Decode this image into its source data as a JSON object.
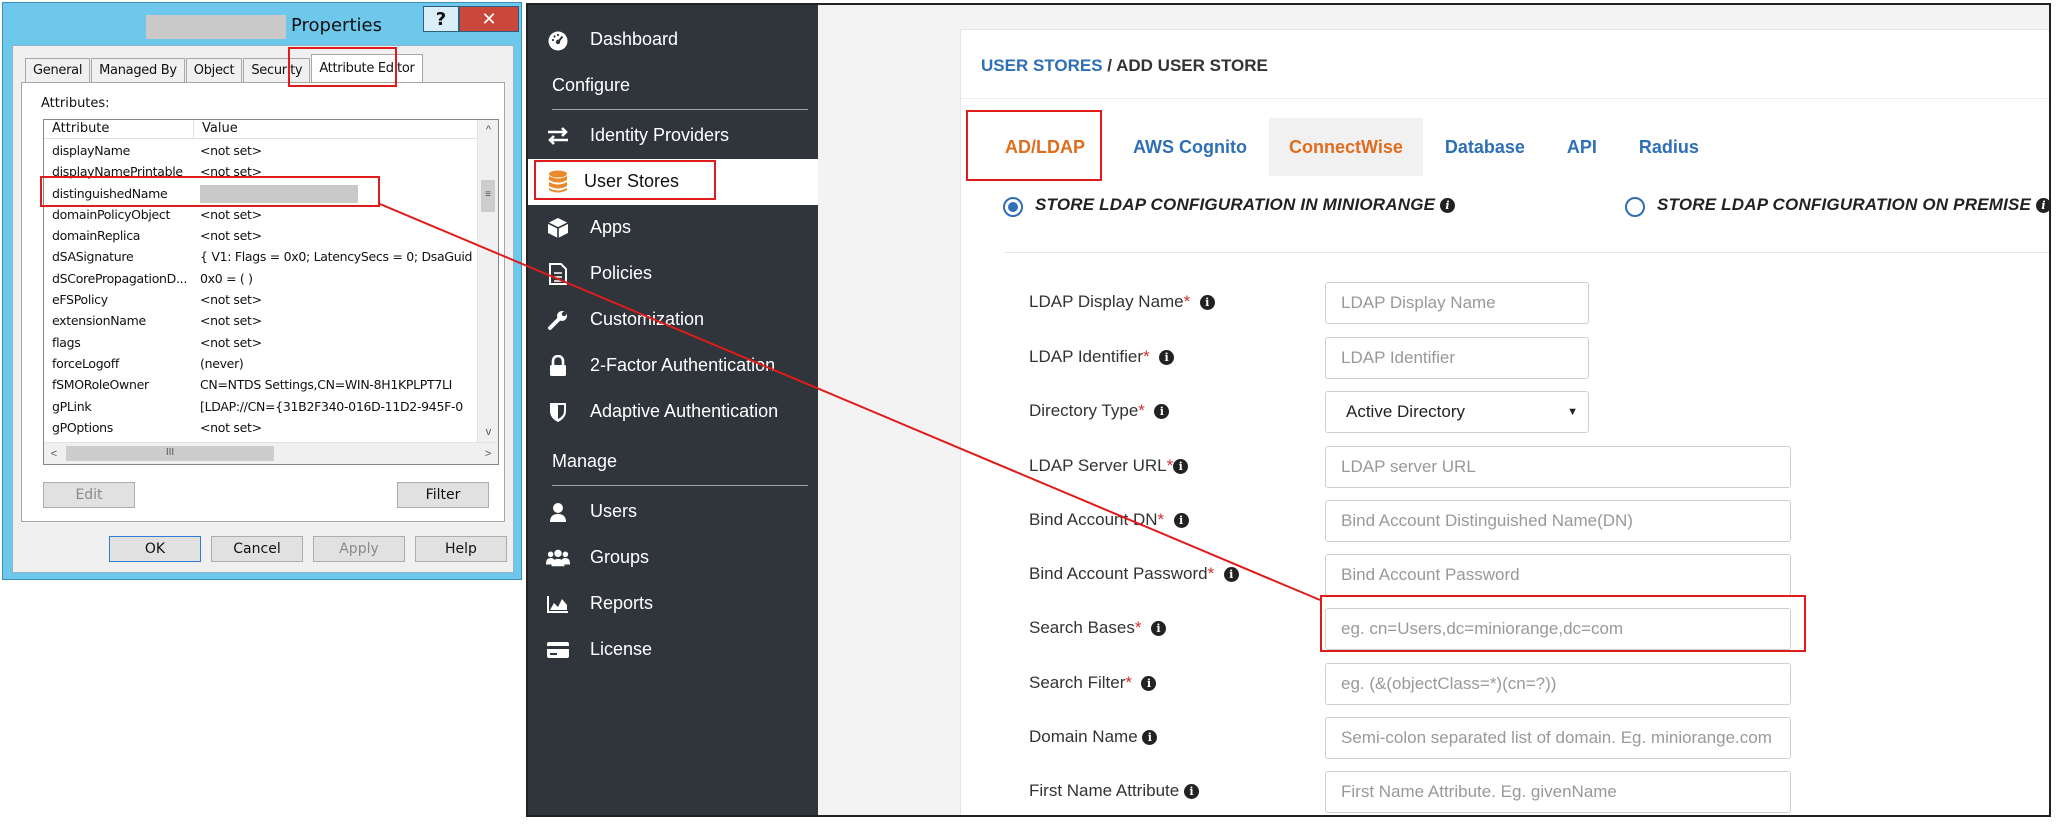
{
  "dialog": {
    "title": "Properties",
    "help_button": "?",
    "close_button": "✕",
    "tabs": [
      "General",
      "Managed By",
      "Object",
      "Security",
      "Attribute Editor"
    ],
    "attributes_caption": "Attributes:",
    "columns": {
      "attribute": "Attribute",
      "value": "Value"
    },
    "rows": [
      {
        "attribute": "displayName",
        "value": "<not set>"
      },
      {
        "attribute": "displayNamePrintable",
        "value": "<not set>"
      },
      {
        "attribute": "distinguishedName",
        "value": ""
      },
      {
        "attribute": "domainPolicyObject",
        "value": "<not set>"
      },
      {
        "attribute": "domainReplica",
        "value": "<not set>"
      },
      {
        "attribute": "dSASignature",
        "value": "{ V1: Flags = 0x0; LatencySecs = 0; DsaGuid"
      },
      {
        "attribute": "dSCorePropagationD...",
        "value": "0x0 = ( )"
      },
      {
        "attribute": "eFSPolicy",
        "value": "<not set>"
      },
      {
        "attribute": "extensionName",
        "value": "<not set>"
      },
      {
        "attribute": "flags",
        "value": "<not set>"
      },
      {
        "attribute": "forceLogoff",
        "value": "(never)"
      },
      {
        "attribute": "fSMORoleOwner",
        "value": "CN=NTDS Settings,CN=WIN-8H1KPLPT7LI"
      },
      {
        "attribute": "gPLink",
        "value": "[LDAP://CN={31B2F340-016D-11D2-945F-0"
      },
      {
        "attribute": "gPOptions",
        "value": "<not set>"
      }
    ],
    "scroll_left": "<",
    "scroll_right": ">",
    "scroll_up": "^",
    "scroll_down": "v",
    "scroll_grip": "III",
    "scroll_grip_v": "≡",
    "edit_button": "Edit",
    "filter_button": "Filter",
    "ok_button": "OK",
    "cancel_button": "Cancel",
    "apply_button": "Apply",
    "help_footer_button": "Help"
  },
  "sidebar": {
    "items_top": [
      {
        "label": "Dashboard",
        "icon": "dashboard-icon"
      }
    ],
    "section_configure": "Configure",
    "items_configure": [
      {
        "label": "Identity Providers",
        "icon": "arrows-exchange-icon"
      },
      {
        "label": "User Stores",
        "icon": "database-icon"
      },
      {
        "label": "Apps",
        "icon": "cube-icon"
      },
      {
        "label": "Policies",
        "icon": "document-icon"
      },
      {
        "label": "Customization",
        "icon": "wrench-icon"
      },
      {
        "label": "2-Factor Authentication",
        "icon": "lock-icon"
      },
      {
        "label": "Adaptive Authentication",
        "icon": "shield-icon"
      }
    ],
    "section_manage": "Manage",
    "items_manage": [
      {
        "label": "Users",
        "icon": "user-icon"
      },
      {
        "label": "Groups",
        "icon": "users-icon"
      },
      {
        "label": "Reports",
        "icon": "area-chart-icon"
      },
      {
        "label": "License",
        "icon": "credit-card-icon"
      }
    ]
  },
  "breadcrumb": {
    "link": "USER STORES",
    "separator": " / ",
    "current": "ADD USER STORE"
  },
  "tabs": [
    "AD/LDAP",
    "AWS Cognito",
    "ConnectWise",
    "Database",
    "API",
    "Radius"
  ],
  "radios": [
    {
      "label": "STORE LDAP CONFIGURATION IN MINIORANGE",
      "checked": true
    },
    {
      "label": "STORE LDAP CONFIGURATION ON PREMISE",
      "checked": false
    }
  ],
  "form": [
    {
      "label": "LDAP Display Name",
      "required": true,
      "placeholder": "LDAP Display Name",
      "type": "text"
    },
    {
      "label": "LDAP Identifier",
      "required": true,
      "placeholder": "LDAP Identifier",
      "type": "text"
    },
    {
      "label": "Directory Type",
      "required": true,
      "value": "Active Directory",
      "type": "select"
    },
    {
      "label": "LDAP Server URL",
      "required": true,
      "placeholder": "LDAP server URL",
      "type": "text"
    },
    {
      "label": "Bind Account DN",
      "required": true,
      "placeholder": "Bind Account Distinguished Name(DN)",
      "type": "text"
    },
    {
      "label": "Bind Account Password",
      "required": true,
      "placeholder": "Bind Account Password",
      "type": "password"
    },
    {
      "label": "Search Bases",
      "required": true,
      "placeholder": "eg. cn=Users,dc=miniorange,dc=com",
      "type": "text"
    },
    {
      "label": "Search Filter",
      "required": true,
      "placeholder": "eg. (&(objectClass=*)(cn=?))",
      "type": "text"
    },
    {
      "label": "Domain Name",
      "required": false,
      "placeholder": "Semi-colon separated list of domain. Eg. miniorange.com",
      "type": "text"
    },
    {
      "label": "First Name Attribute",
      "required": false,
      "placeholder": "First Name Attribute. Eg. givenName",
      "type": "text"
    }
  ],
  "colors": {
    "accent_link": "#2f6fb5",
    "active_tab": "#e06c1e",
    "sidebar_bg": "#2f353b",
    "highlight_red": "#e01b1b",
    "required_star": "#d0302f"
  },
  "required_mark": "*",
  "info_mark": "i",
  "select_caret": "▼"
}
